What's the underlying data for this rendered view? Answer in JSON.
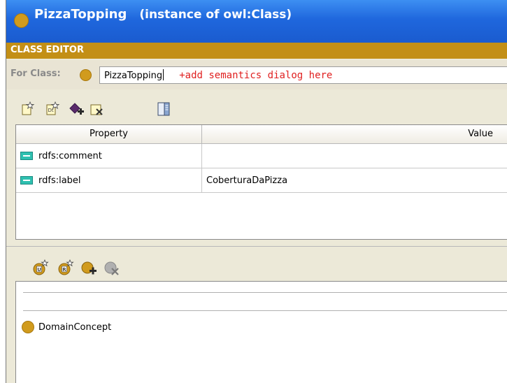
{
  "window": {
    "title_class": "PizzaTopping",
    "title_suffix": "(instance of owl:Class)"
  },
  "section_header": "CLASS EDITOR",
  "for_class": {
    "label": "For Class:",
    "value": "PizzaTopping",
    "annotation": "+add semantics dialog here"
  },
  "toolbar_top": {
    "icons": [
      "create-property-icon",
      "create-datatype-property-icon",
      "add-restriction-icon",
      "remove-icon",
      "view-panel-icon"
    ]
  },
  "property_table": {
    "headers": [
      "Property",
      "Value"
    ],
    "rows": [
      {
        "property": "rdfs:comment",
        "value": ""
      },
      {
        "property": "rdfs:label",
        "value": "CoberturaDaPizza"
      }
    ]
  },
  "toolbar_bottom": {
    "icons": [
      "create-named-class-icon",
      "create-restriction-icon",
      "add-superclass-icon",
      "remove-superclass-icon"
    ]
  },
  "superclass_list": {
    "items": [
      "DomainConcept"
    ]
  },
  "colors": {
    "title_bar": "#1f67dd",
    "section_header": "#c38f16",
    "class_dot": "#d19b1d",
    "property_icon": "#2fc0b0",
    "annotation_text": "#e02020"
  }
}
